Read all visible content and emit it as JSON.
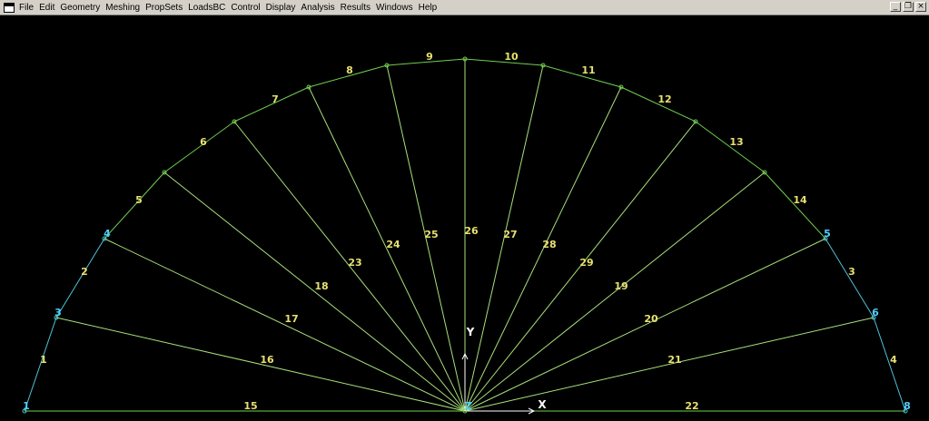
{
  "menubar": {
    "items": [
      "File",
      "Edit",
      "Geometry",
      "Meshing",
      "PropSets",
      "LoadsBC",
      "Control",
      "Display",
      "Analysis",
      "Results",
      "Windows",
      "Help"
    ],
    "window_controls": [
      "_",
      "❐",
      "×"
    ]
  },
  "colors": {
    "background": "#000000",
    "arc_line": "#6fcf4f",
    "radial_line": "#a8e07a",
    "side_line": "#4fc3d8",
    "line_label": "#e8e070",
    "keypoint_label": "#4fd0ff",
    "axis": "#ffffff"
  },
  "model": {
    "keypoint_labels": [
      "1",
      "3",
      "4",
      "5",
      "6",
      "8",
      "Z"
    ],
    "line_labels": [
      "1",
      "2",
      "3",
      "4",
      "5",
      "6",
      "7",
      "8",
      "9",
      "10",
      "11",
      "12",
      "13",
      "14",
      "15",
      "16",
      "17",
      "18",
      "19",
      "20",
      "21",
      "22",
      "23",
      "24",
      "25",
      "26",
      "27",
      "28",
      "29"
    ],
    "axis_labels": {
      "x": "X",
      "y": "Y"
    }
  }
}
